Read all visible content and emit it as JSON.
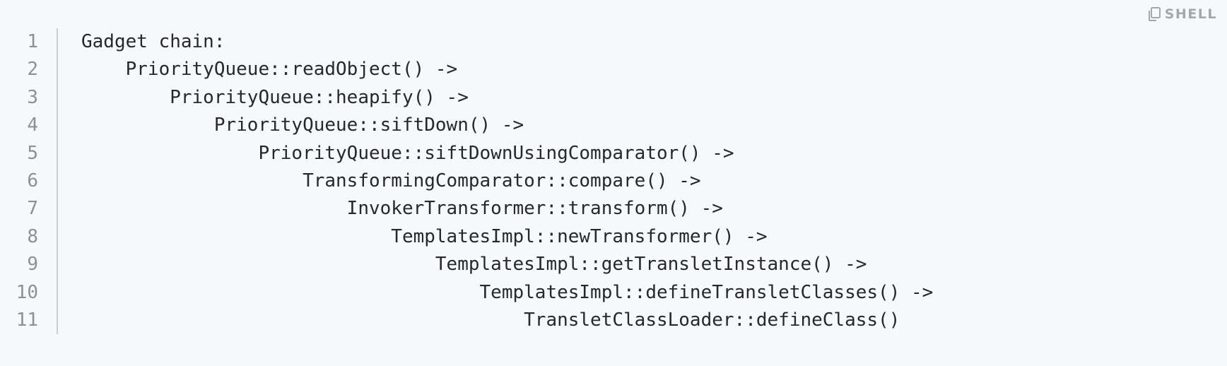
{
  "badge": {
    "label": "SHELL",
    "icon": "copy-icon"
  },
  "code": {
    "line_numbers": [
      "1",
      "2",
      "3",
      "4",
      "5",
      "6",
      "7",
      "8",
      "9",
      "10",
      "11"
    ],
    "lines": [
      "Gadget chain:",
      "    PriorityQueue::readObject() ->",
      "        PriorityQueue::heapify() ->",
      "            PriorityQueue::siftDown() ->",
      "                PriorityQueue::siftDownUsingComparator() ->",
      "                    TransformingComparator::compare() ->",
      "                        InvokerTransformer::transform() ->",
      "                            TemplatesImpl::newTransformer() ->",
      "                                TemplatesImpl::getTransletInstance() ->",
      "                                    TemplatesImpl::defineTransletClasses() ->",
      "                                        TransletClassLoader::defineClass()"
    ]
  },
  "colors": {
    "background": "#f6f8fa",
    "text": "#24292e",
    "line_number": "#8c9196",
    "badge": "#a3a8ae"
  }
}
